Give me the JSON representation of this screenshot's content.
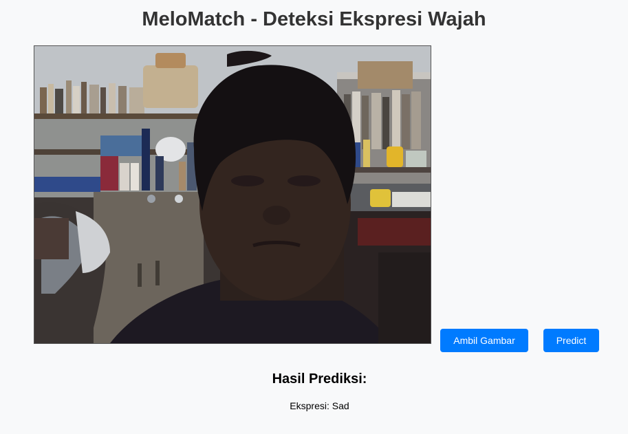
{
  "page": {
    "title": "MeloMatch - Deteksi Ekspresi Wajah"
  },
  "webcam": {
    "content": "live webcam frame showing a person in a cluttered room with bookshelves"
  },
  "controls": {
    "capture_label": "Ambil Gambar",
    "predict_label": "Predict"
  },
  "result": {
    "heading": "Hasil Prediksi:",
    "expression_prefix": "Ekspresi: ",
    "expression_value": "Sad"
  },
  "colors": {
    "background": "#f8f9fa",
    "title": "#333333",
    "button": "#007bff",
    "button_text": "#ffffff"
  }
}
